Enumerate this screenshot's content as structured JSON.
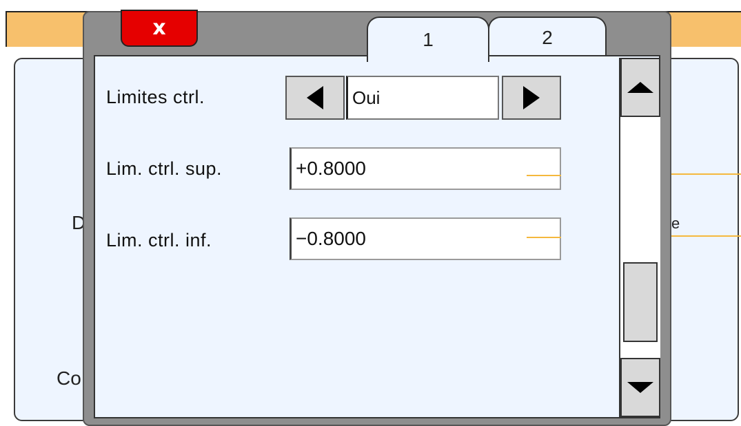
{
  "background": {
    "partial_text_left_1": "D",
    "partial_text_left_2": "Co",
    "partial_text_right": "e"
  },
  "dialog": {
    "close_label": "x",
    "tabs": [
      {
        "label": "1",
        "active": true
      },
      {
        "label": "2",
        "active": false
      }
    ],
    "fields": {
      "control_limits": {
        "label": "Limites  ctrl.",
        "value": "Oui"
      },
      "upper_limit": {
        "label": "Lim.  ctrl.  sup.",
        "value": "+0.8000"
      },
      "lower_limit": {
        "label": "Lim.  ctrl.  inf.",
        "value": "−0.8000"
      }
    },
    "scrollbar": {
      "up_icon": "triangle-up-icon",
      "down_icon": "triangle-down-icon",
      "thumb_position": 0.9
    }
  },
  "colors": {
    "header": "#f7c06c",
    "close_button": "#e50000",
    "panel": "#eef5ff",
    "accent_line": "#f5b83d"
  }
}
